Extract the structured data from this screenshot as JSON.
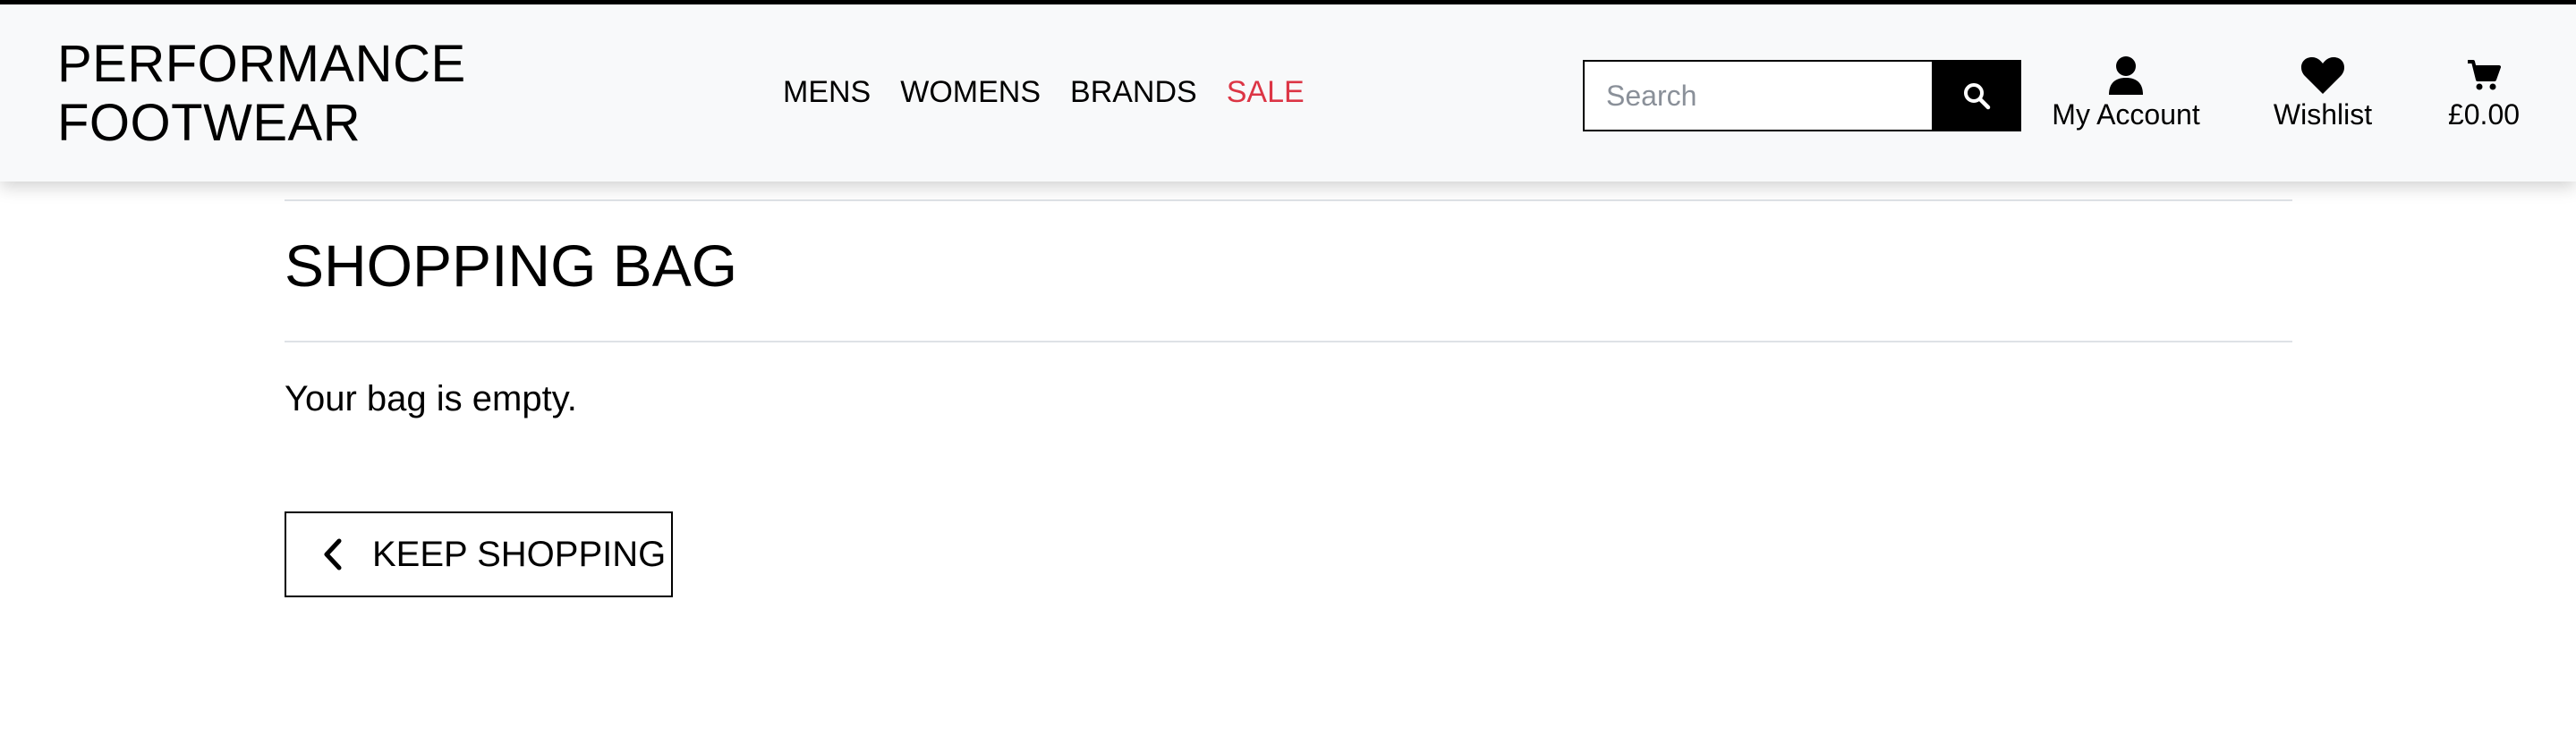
{
  "header": {
    "logo": {
      "line1": "PERFORMANCE",
      "line2": "FOOTWEAR"
    },
    "nav": [
      {
        "label": "MENS"
      },
      {
        "label": "WOMENS"
      },
      {
        "label": "BRANDS"
      },
      {
        "label": "SALE"
      }
    ],
    "search": {
      "placeholder": "Search",
      "value": "",
      "icon": "search-icon"
    },
    "account": {
      "label": "My Account",
      "icon": "user-icon"
    },
    "wishlist": {
      "label": "Wishlist",
      "icon": "heart-icon"
    },
    "bag": {
      "total": "£0.00",
      "icon": "shopping-cart-icon"
    }
  },
  "main": {
    "title": "SHOPPING BAG",
    "empty_message": "Your bag is empty.",
    "keep_shopping": {
      "label": "KEEP SHOPPING",
      "icon": "chevron-left-icon"
    }
  },
  "colors": {
    "sale": "#dc3545",
    "header_bg": "#f8f9fa",
    "accent": "#000000",
    "divider": "#dee2e6"
  }
}
